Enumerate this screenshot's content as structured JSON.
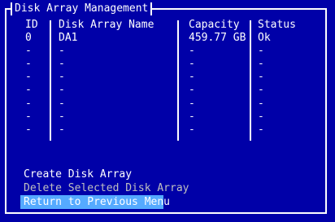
{
  "window": {
    "title": "Disk Array Management"
  },
  "table": {
    "headers": {
      "id": "ID",
      "name": "Disk Array Name",
      "capacity": "Capacity",
      "status": "Status"
    },
    "rows": [
      {
        "id": "0",
        "name": "DA1",
        "capacity": "459.77 GB",
        "status": "Ok"
      },
      {
        "id": "-",
        "name": "-",
        "capacity": "-",
        "status": "-"
      },
      {
        "id": "-",
        "name": "-",
        "capacity": "-",
        "status": "-"
      },
      {
        "id": "-",
        "name": "-",
        "capacity": "-",
        "status": "-"
      },
      {
        "id": "-",
        "name": "-",
        "capacity": "-",
        "status": "-"
      },
      {
        "id": "-",
        "name": "-",
        "capacity": "-",
        "status": "-"
      },
      {
        "id": "-",
        "name": "-",
        "capacity": "-",
        "status": "-"
      },
      {
        "id": "-",
        "name": "-",
        "capacity": "-",
        "status": "-"
      }
    ]
  },
  "menu": {
    "items": [
      {
        "label": "Create Disk Array",
        "state": "enabled"
      },
      {
        "label": "Delete Selected Disk Array",
        "state": "disabled"
      },
      {
        "label": "Return to Previous Menu",
        "state": "selected"
      }
    ]
  },
  "colors": {
    "background": "#0000a8",
    "text": "#ffffff",
    "disabled_text": "#c0c0c0",
    "highlight": "#55aaff"
  }
}
